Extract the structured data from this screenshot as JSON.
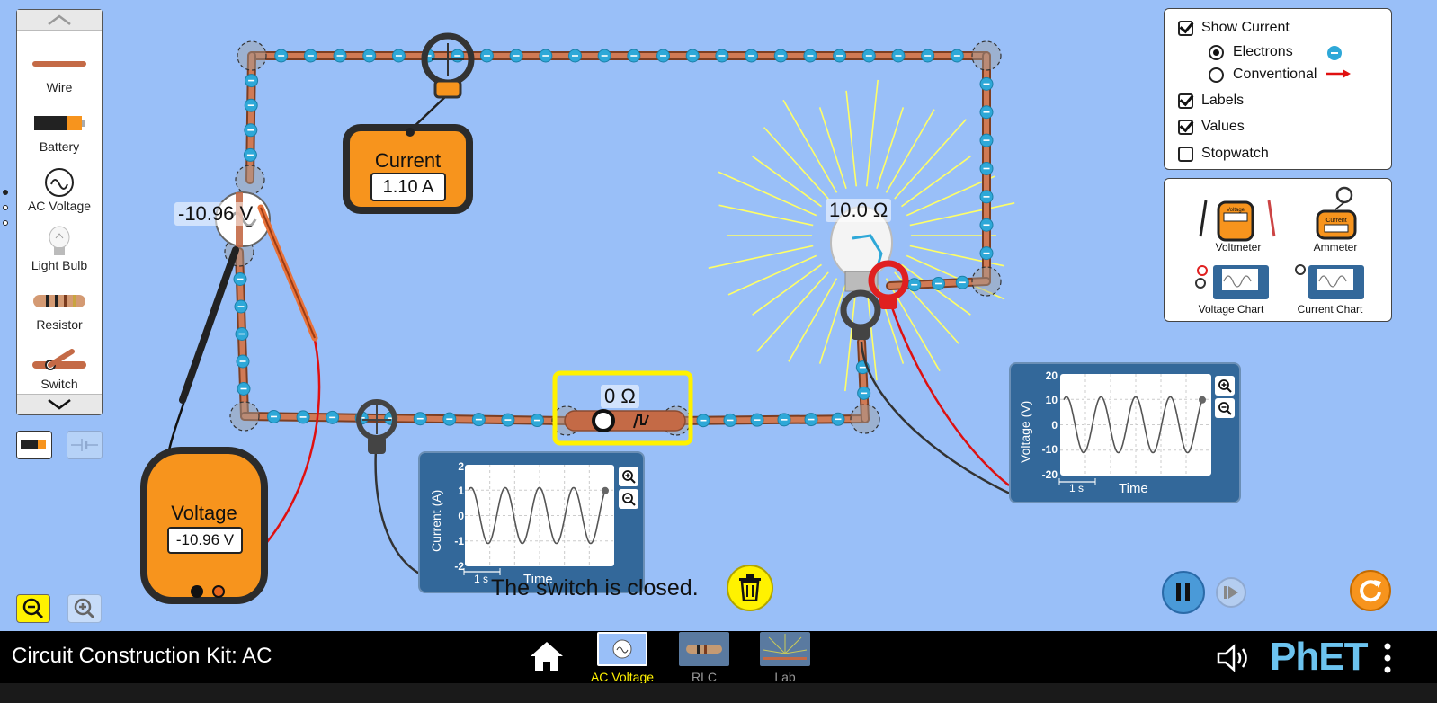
{
  "app": {
    "title": "Circuit Construction Kit: AC",
    "brand": "PhET"
  },
  "colors": {
    "background": "#99bff8",
    "wire": "#c46a46",
    "electron": "#2ea8d8",
    "meter_orange": "#f7941d",
    "highlight_yellow": "#fff200",
    "chart_blue": "#33689a"
  },
  "carousel": {
    "items": [
      {
        "label": "Wire",
        "icon": "wire-icon"
      },
      {
        "label": "Battery",
        "icon": "battery-icon"
      },
      {
        "label": "AC Voltage",
        "icon": "ac-voltage-icon"
      },
      {
        "label": "Light Bulb",
        "icon": "light-bulb-icon"
      },
      {
        "label": "Resistor",
        "icon": "resistor-icon"
      },
      {
        "label": "Switch",
        "icon": "switch-icon"
      }
    ],
    "page_count": 3,
    "active_page": 1
  },
  "options": {
    "show_current": {
      "label": "Show Current",
      "checked": true
    },
    "electrons": {
      "label": "Electrons",
      "selected": true
    },
    "conventional": {
      "label": "Conventional",
      "selected": false
    },
    "labels": {
      "label": "Labels",
      "checked": true
    },
    "values": {
      "label": "Values",
      "checked": true
    },
    "stopwatch": {
      "label": "Stopwatch",
      "checked": false
    }
  },
  "tools": {
    "voltmeter": "Voltmeter",
    "ammeter": "Ammeter",
    "voltage_chart": "Voltage Chart",
    "current_chart": "Current Chart",
    "mini_voltmeter_text": "Voltage",
    "mini_ammeter_text": "Current"
  },
  "circuit": {
    "ac_source_label": "-10.96 V",
    "bulb_label": "10.0 Ω",
    "switch_label": "0 Ω"
  },
  "ammeter": {
    "title": "Current",
    "value": "1.10 A"
  },
  "voltmeter": {
    "title": "Voltage",
    "value": "-10.96 V"
  },
  "current_chart": {
    "ylabel": "Current (A)",
    "xlabel": "Time",
    "scale": "1 s",
    "ticks": [
      "2",
      "1",
      "0",
      "-1",
      "-2"
    ],
    "ylim": [
      -2,
      2
    ],
    "amplitude": 1.1,
    "cycles": 4
  },
  "voltage_chart": {
    "ylabel": "Voltage (V)",
    "xlabel": "Time",
    "scale": "1 s",
    "ticks": [
      "20",
      "10",
      "0",
      "-10",
      "-20"
    ],
    "ylim": [
      -20,
      20
    ],
    "amplitude": 11,
    "cycles": 4
  },
  "status": {
    "message": "The switch is closed."
  },
  "navbar": {
    "screens": [
      {
        "label": "AC Voltage",
        "selected": true
      },
      {
        "label": "RLC",
        "selected": false
      },
      {
        "label": "Lab",
        "selected": false
      }
    ]
  }
}
